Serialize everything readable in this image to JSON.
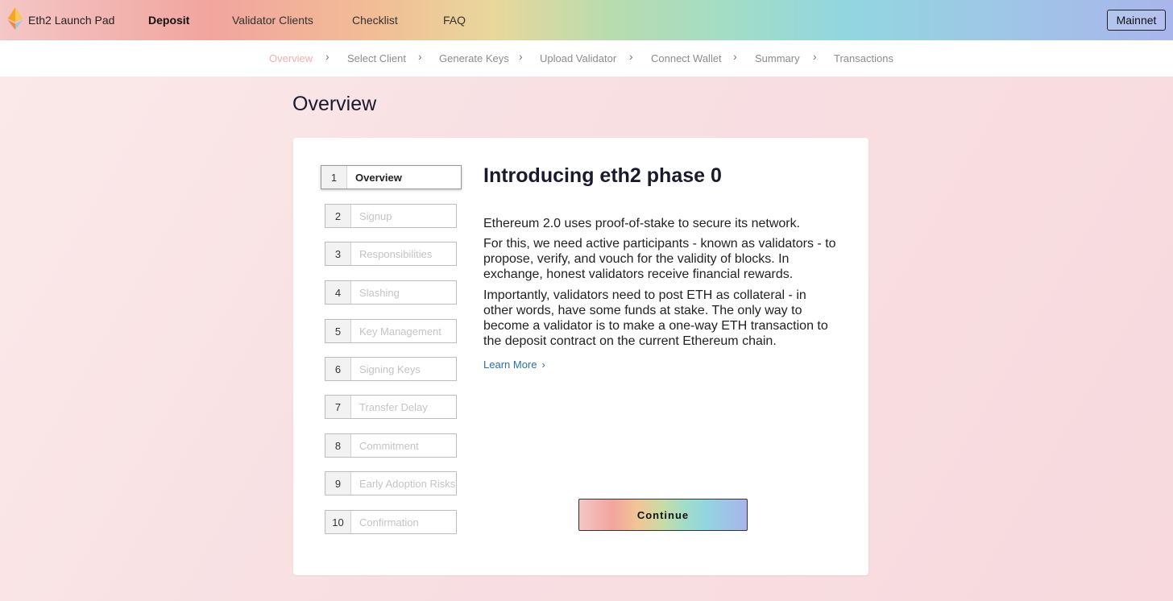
{
  "header": {
    "brand": "Eth2 Launch Pad",
    "nav": [
      "Deposit",
      "Validator Clients",
      "Checklist",
      "FAQ"
    ],
    "active_nav": "Deposit",
    "network_button": "Mainnet"
  },
  "steps": [
    "Overview",
    "Select Client",
    "Generate Keys",
    "Upload Validator",
    "Connect Wallet",
    "Summary",
    "Transactions"
  ],
  "page_title": "Overview",
  "sidebar": {
    "items": [
      {
        "num": "1",
        "label": "Overview"
      },
      {
        "num": "2",
        "label": "Signup"
      },
      {
        "num": "3",
        "label": "Responsibilities"
      },
      {
        "num": "4",
        "label": "Slashing"
      },
      {
        "num": "5",
        "label": "Key Management"
      },
      {
        "num": "6",
        "label": "Signing Keys"
      },
      {
        "num": "7",
        "label": "Transfer Delay"
      },
      {
        "num": "8",
        "label": "Commitment"
      },
      {
        "num": "9",
        "label": "Early Adoption Risks"
      },
      {
        "num": "10",
        "label": "Confirmation"
      }
    ]
  },
  "content": {
    "title": "Introducing eth2 phase 0",
    "paragraphs": [
      "Ethereum 2.0 uses proof-of-stake to secure its network.",
      "For this, we need active participants - known as validators - to propose, verify, and vouch for the validity of blocks. In exchange, honest validators receive financial rewards.",
      "Importantly, validators need to post ETH as collateral - in other words, have some funds at stake. The only way to become a validator is to make a one-way ETH transaction to the deposit contract on the current Ethereum chain."
    ],
    "learn_more": "Learn More",
    "continue": "Continue"
  },
  "colors": {
    "link": "#2a6fa8",
    "active_step": "#f2b0b0"
  }
}
